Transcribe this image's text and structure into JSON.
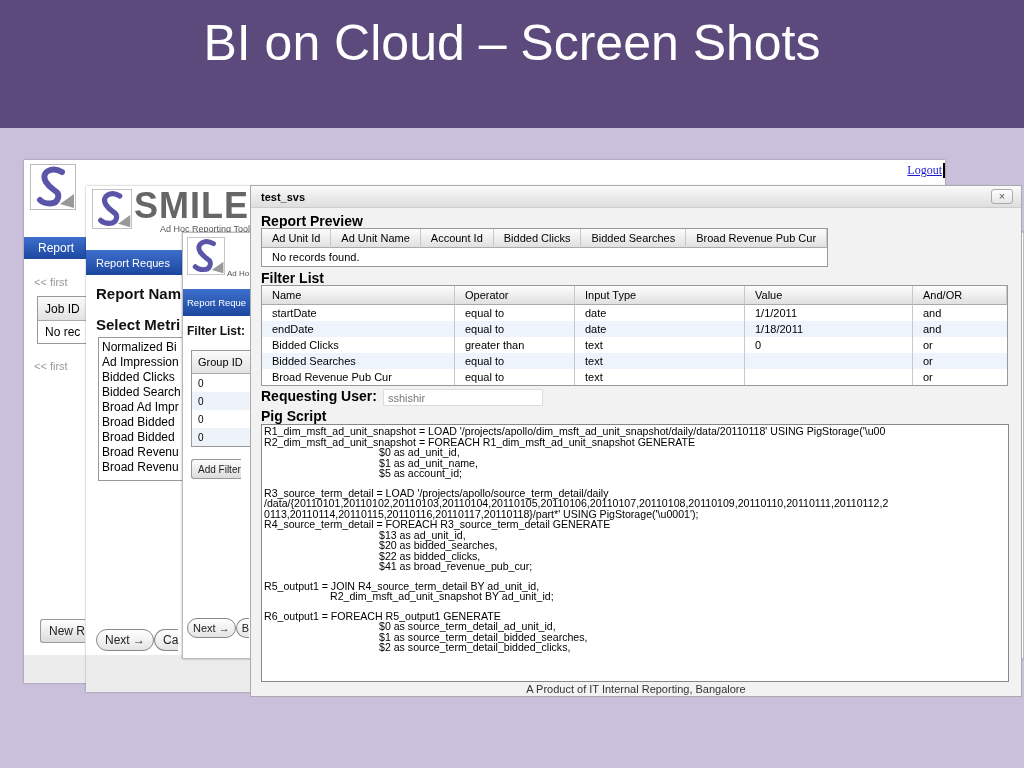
{
  "slide": {
    "title": "BI on Cloud – Screen Shots"
  },
  "jobs_screen": {
    "logout": "Logout",
    "section_bar": "Report",
    "pager_top": "<< first",
    "table": {
      "columns": [
        "Job ID"
      ],
      "rows": [
        [
          "No rec"
        ]
      ]
    },
    "pager_bottom": "<< first",
    "new_button": "New R"
  },
  "metrics_screen": {
    "brand": "SMILE",
    "tagline": "Ad Hoc Reporting Tool",
    "section_bar": "Report Reques",
    "report_name_label": "Report Nam",
    "metrics_label": "Select Metri",
    "metrics": [
      "Normalized Bi",
      "Ad Impression",
      "Bidded Clicks",
      "Bidded Search",
      "Broad Ad Impr",
      "Broad Bidded",
      "Broad Bidded",
      "Broad Revenu",
      "Broad Revenu"
    ],
    "buttons": [
      "Next →",
      "Ca"
    ]
  },
  "filters_screen": {
    "tagline": "Ad Ho",
    "section_bar": "Report Reque",
    "filter_label": "Filter List:",
    "table": {
      "columns": [
        "Group ID"
      ],
      "rows": [
        [
          "0"
        ],
        [
          "0"
        ],
        [
          "0"
        ],
        [
          "0"
        ]
      ]
    },
    "add_button": "Add Filter",
    "buttons": [
      "Next →",
      "B"
    ]
  },
  "dialog": {
    "title": "test_svs",
    "close": "×",
    "preview": {
      "heading": "Report Preview",
      "columns": [
        "Ad Unit Id",
        "Ad Unit Name",
        "Account Id",
        "Bidded Clicks",
        "Bidded Searches",
        "Broad Revenue Pub Cur"
      ],
      "empty_text": "No records found."
    },
    "filter_list": {
      "heading": "Filter List",
      "columns": [
        "Name",
        "Operator",
        "Input Type",
        "Value",
        "And/OR"
      ],
      "rows": [
        {
          "name": "startDate",
          "operator": "equal to",
          "input_type": "date",
          "value": "1/1/2011",
          "and_or": "and"
        },
        {
          "name": "endDate",
          "operator": "equal to",
          "input_type": "date",
          "value": "1/18/2011",
          "and_or": "and"
        },
        {
          "name": "Bidded Clicks",
          "operator": "greater than",
          "input_type": "text",
          "value": "0",
          "and_or": "or"
        },
        {
          "name": "Bidded Searches",
          "operator": "equal to",
          "input_type": "text",
          "and_or": "or"
        },
        {
          "name": "Broad Revenue Pub Cur",
          "operator": "equal to",
          "input_type": "text",
          "and_or": "or"
        }
      ]
    },
    "requesting_user": {
      "label": "Requesting User:",
      "value": "sshishir"
    },
    "pig_script": {
      "heading": "Pig Script",
      "blocks": [
        {
          "lines": [
            {
              "kind": "statement",
              "text": "R1_dim_msft_ad_unit_snapshot = LOAD '/projects/apollo/dim_msft_ad_unit_snapshot/daily/data/20110118' USING PigStorage('\\u00"
            },
            {
              "kind": "statement",
              "text": "R2_dim_msft_ad_unit_snapshot = FOREACH R1_dim_msft_ad_unit_snapshot GENERATE"
            },
            {
              "kind": "field",
              "text": "$0 as ad_unit_id,"
            },
            {
              "kind": "field",
              "text": "$1 as ad_unit_name,"
            },
            {
              "kind": "field",
              "text": "$5 as account_id;"
            }
          ]
        },
        {
          "lines": [
            {
              "kind": "statement",
              "text": "R3_source_term_detail = LOAD '/projects/apollo/source_term_detail/daily"
            },
            {
              "kind": "statement",
              "text": "/data/{20110101,20110102,20110103,20110104,20110105,20110106,20110107,20110108,20110109,20110110,20110111,20110112,2"
            },
            {
              "kind": "statement",
              "text": "0113,20110114,20110115,20110116,20110117,20110118}/part*' USING PigStorage('\\u0001');"
            },
            {
              "kind": "statement",
              "text": "R4_source_term_detail = FOREACH R3_source_term_detail GENERATE"
            },
            {
              "kind": "field",
              "text": "$13 as ad_unit_id,"
            },
            {
              "kind": "field",
              "text": "$20 as bidded_searches,"
            },
            {
              "kind": "field",
              "text": "$22 as bidded_clicks,"
            },
            {
              "kind": "field",
              "text": "$41 as broad_revenue_pub_cur;"
            }
          ]
        },
        {
          "lines": [
            {
              "kind": "statement",
              "text": "R5_output1 = JOIN R4_source_term_detail BY ad_unit_id,"
            },
            {
              "kind": "clause",
              "text": "R2_dim_msft_ad_unit_snapshot BY ad_unit_id;"
            }
          ]
        },
        {
          "lines": [
            {
              "kind": "statement",
              "text": "R6_output1 = FOREACH R5_output1 GENERATE"
            },
            {
              "kind": "field",
              "text": "$0 as source_term_detail_ad_unit_id,"
            },
            {
              "kind": "field",
              "text": "$1 as source_term_detail_bidded_searches,"
            },
            {
              "kind": "field",
              "text": "$2 as source_term_detail_bidded_clicks,"
            }
          ]
        }
      ]
    },
    "footer": "A Product of IT Internal Reporting, Bangalore"
  }
}
